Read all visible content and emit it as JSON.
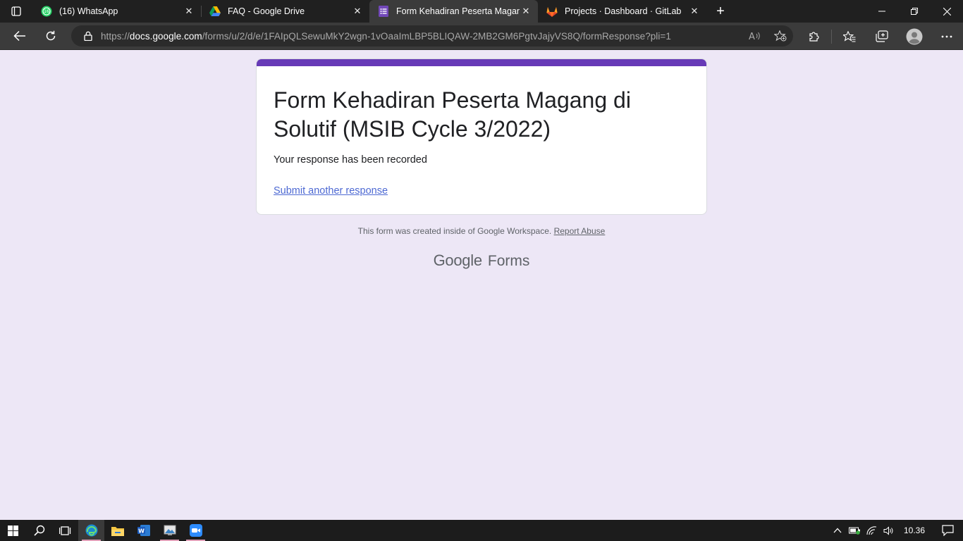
{
  "browser": {
    "tabs": [
      {
        "title": "(16) WhatsApp",
        "badge": "16",
        "icon": "whatsapp-icon",
        "active": false
      },
      {
        "title": "FAQ - Google Drive",
        "icon": "google-drive-icon",
        "active": false
      },
      {
        "title": "Form Kehadiran Peserta Magang di Solutif (MSIB Cycle 3/2022)",
        "icon": "google-forms-icon",
        "active": true
      },
      {
        "title": "Projects · Dashboard · GitLab",
        "icon": "gitlab-icon",
        "active": false
      }
    ],
    "address": {
      "prefix": "https://",
      "host": "docs.google.com",
      "path": "/forms/u/2/d/e/1FAIpQLSewuMkY2wgn-1vOaaImLBP5BLIQAW-2MB2GM6PgtvJajyVS8Q/formResponse?pli=1"
    }
  },
  "page": {
    "form_title": "Form Kehadiran Peserta Magang di Solutif (MSIB Cycle 3/2022)",
    "confirmation": "Your response has been recorded",
    "submit_another": "Submit another response",
    "footer_text": "This form was created inside of Google Workspace.",
    "report_abuse": "Report Abuse",
    "brand_google": "Google",
    "brand_forms": "Forms"
  },
  "taskbar": {
    "time": "10.36"
  },
  "colors": {
    "accent": "#673ab7",
    "page_bg": "#ede7f6",
    "link": "#4d69d3"
  }
}
